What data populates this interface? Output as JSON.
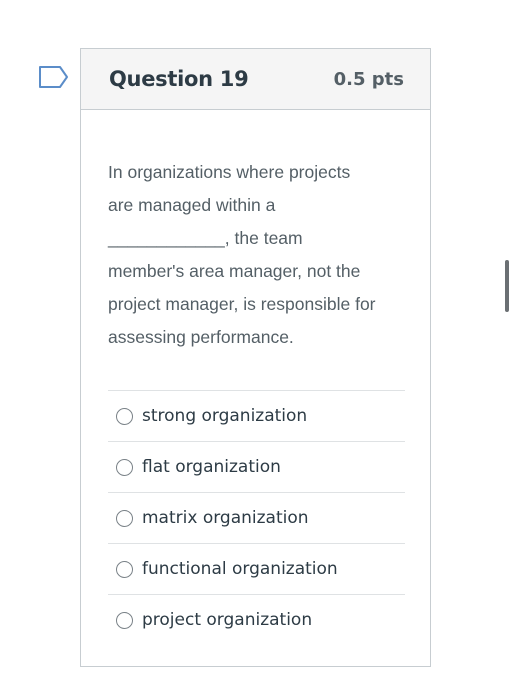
{
  "question": {
    "title": "Question 19",
    "points": "0.5 pts",
    "text_lines": [
      "In organizations where projects",
      "are managed within a",
      "____________, the team",
      "member's area manager, not the",
      "project manager, is responsible for",
      "assessing performance."
    ]
  },
  "answers": [
    {
      "label": "strong organization",
      "selected": false
    },
    {
      "label": "flat organization",
      "selected": false
    },
    {
      "label": "matrix organization",
      "selected": false
    },
    {
      "label": "functional organization",
      "selected": false
    },
    {
      "label": "project organization",
      "selected": false
    }
  ],
  "icons": {
    "flag": "flag-icon"
  },
  "colors": {
    "header_bg": "#f5f5f5",
    "border": "#c7cdd1",
    "flag_stroke": "#5b8dc9",
    "text": "#2d3b45"
  }
}
